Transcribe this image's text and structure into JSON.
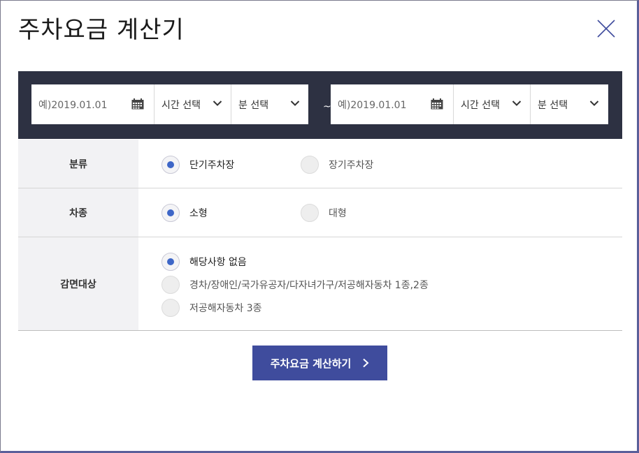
{
  "dialog": {
    "title": "주차요금 계산기"
  },
  "datetime": {
    "start": {
      "date_placeholder": "예)2019.01.01",
      "hour_select": "시간 선택",
      "minute_select": "분 선택"
    },
    "separator": "~",
    "end": {
      "date_placeholder": "예)2019.01.01",
      "hour_select": "시간 선택",
      "minute_select": "분 선택"
    }
  },
  "form": {
    "category": {
      "label": "분류",
      "options": [
        {
          "label": "단기주차장",
          "selected": true
        },
        {
          "label": "장기주차장",
          "selected": false
        }
      ]
    },
    "vehicle": {
      "label": "차종",
      "options": [
        {
          "label": "소형",
          "selected": true
        },
        {
          "label": "대형",
          "selected": false
        }
      ]
    },
    "discount": {
      "label": "감면대상",
      "options": [
        {
          "label": "해당사항 없음",
          "selected": true
        },
        {
          "label": "경차/장애인/국가유공자/다자녀가구/저공해자동차 1종,2종",
          "selected": false
        },
        {
          "label": "저공해자동차 3종",
          "selected": false
        }
      ]
    }
  },
  "actions": {
    "calculate_label": "주차요금 계산하기"
  },
  "colors": {
    "header_bar": "#2d3142",
    "primary_button": "#3f4c9d",
    "radio_selected": "#3d66c7",
    "label_background": "#f2f2f4"
  },
  "icons": [
    "close-icon",
    "calendar-icon",
    "chevron-down-icon",
    "chevron-right-icon"
  ]
}
